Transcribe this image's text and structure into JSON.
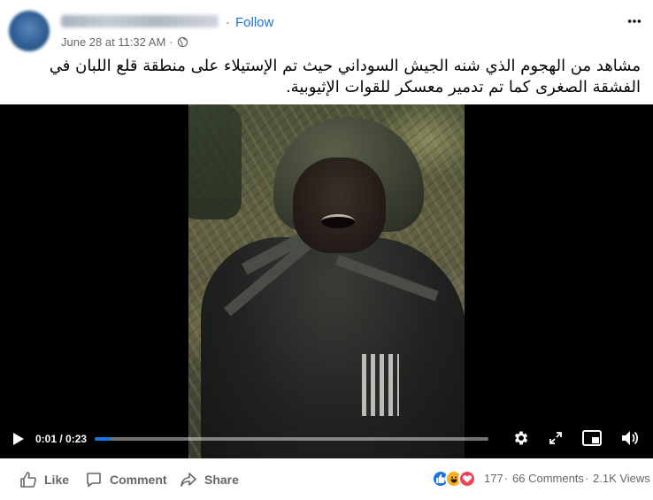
{
  "post": {
    "follow_label": "Follow",
    "separator": "·",
    "timestamp": "June 28 at 11:32 AM",
    "audience_icon": "globe-icon",
    "more_icon": "more-horizontal-icon",
    "caption": "مشاهد من الهجوم الذي شنه الجيش السوداني حيث تم الإستيلاء على منطقة قلع اللبان في الفشقة الصغرى كما تم تدمير معسكر للقوات الإثيوبية."
  },
  "video": {
    "current_time": "0:01",
    "duration": "0:23",
    "timecode": "0:01 / 0:23",
    "progress": 0.04,
    "icons": [
      "play-icon",
      "settings-icon",
      "fullscreen-icon",
      "picture-in-picture-icon",
      "volume-icon"
    ],
    "accent_color": "#1b74e4"
  },
  "footer": {
    "like_label": "Like",
    "comment_label": "Comment",
    "share_label": "Share",
    "reaction_count": "177",
    "comments_count": "66 Comments",
    "views_count": "2.1K Views",
    "dot": "·",
    "reaction_icons": [
      "like-reaction-icon",
      "haha-reaction-icon",
      "love-reaction-icon"
    ]
  }
}
